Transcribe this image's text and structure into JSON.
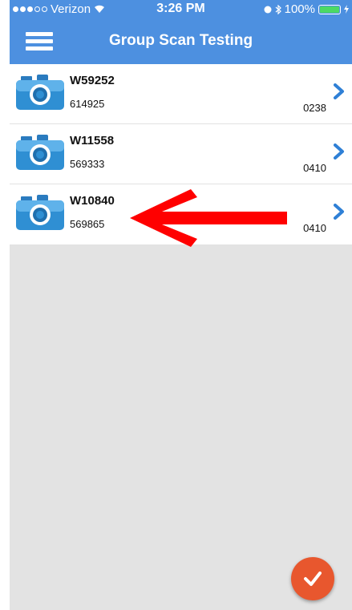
{
  "status_bar": {
    "carrier": "Verizon",
    "time": "3:26 PM",
    "battery": "100%"
  },
  "header": {
    "title": "Group Scan Testing",
    "menu_icon": "hamburger-menu-icon"
  },
  "list": {
    "items": [
      {
        "title": "W59252",
        "subtitle": "614925",
        "code": "0238",
        "icon": "camera-icon"
      },
      {
        "title": "W11558",
        "subtitle": "569333",
        "code": "0410",
        "icon": "camera-icon"
      },
      {
        "title": "W10840",
        "subtitle": "569865",
        "code": "0410",
        "icon": "camera-icon"
      }
    ]
  },
  "fab": {
    "icon": "checkmark-icon"
  },
  "colors": {
    "header": "#4d90e0",
    "accent_chevron": "#2f80d6",
    "fab": "#e8572e",
    "annotation_arrow": "#ff0000",
    "empty_area": "#e3e3e3"
  }
}
